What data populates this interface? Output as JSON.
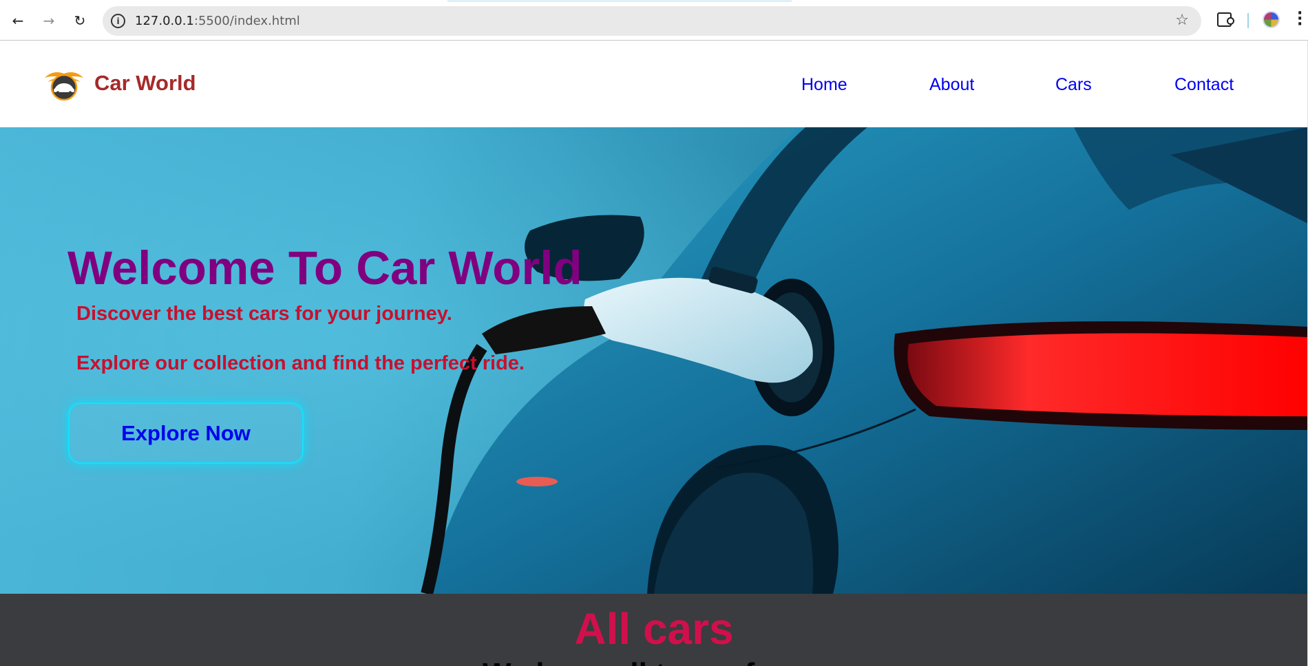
{
  "browser": {
    "url_host": "127.0.0.1",
    "url_path": ":5500/index.html",
    "icons": {
      "back": "back-arrow-icon",
      "forward": "forward-arrow-icon",
      "reload": "reload-icon",
      "site_info": "site-info-icon",
      "bookmark": "star-icon",
      "extensions": "puzzle-icon",
      "profile": "profile-avatar",
      "menu": "kebab-menu-icon"
    }
  },
  "header": {
    "brand": "Car World",
    "nav": [
      {
        "label": "Home"
      },
      {
        "label": "About"
      },
      {
        "label": "Cars"
      },
      {
        "label": "Contact"
      }
    ],
    "brand_color": "#a52a2a",
    "link_color": "#0000ee"
  },
  "hero": {
    "title": "Welcome To Car World",
    "lines": [
      "Discover the best cars for your journey.",
      "Explore our collection and find the perfect ride."
    ],
    "button_label": "Explore Now",
    "title_color": "#800080",
    "text_color": "#c8102e",
    "button_glow": "#16e0ff"
  },
  "cars_section": {
    "title": "All cars",
    "subtitle": "We have all type of cars",
    "background": "#3a3c3f",
    "title_color": "#d0104c"
  }
}
